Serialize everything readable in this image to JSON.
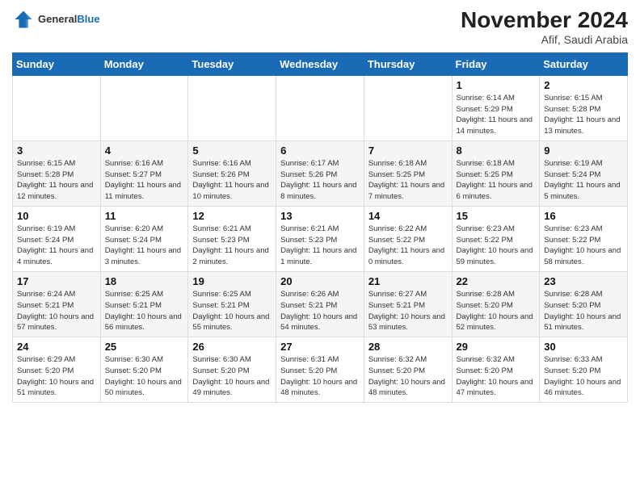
{
  "header": {
    "logo_general": "General",
    "logo_blue": "Blue",
    "month_title": "November 2024",
    "location": "Afif, Saudi Arabia"
  },
  "columns": [
    "Sunday",
    "Monday",
    "Tuesday",
    "Wednesday",
    "Thursday",
    "Friday",
    "Saturday"
  ],
  "weeks": [
    [
      {
        "day": "",
        "info": ""
      },
      {
        "day": "",
        "info": ""
      },
      {
        "day": "",
        "info": ""
      },
      {
        "day": "",
        "info": ""
      },
      {
        "day": "",
        "info": ""
      },
      {
        "day": "1",
        "info": "Sunrise: 6:14 AM\nSunset: 5:29 PM\nDaylight: 11 hours and 14 minutes."
      },
      {
        "day": "2",
        "info": "Sunrise: 6:15 AM\nSunset: 5:28 PM\nDaylight: 11 hours and 13 minutes."
      }
    ],
    [
      {
        "day": "3",
        "info": "Sunrise: 6:15 AM\nSunset: 5:28 PM\nDaylight: 11 hours and 12 minutes."
      },
      {
        "day": "4",
        "info": "Sunrise: 6:16 AM\nSunset: 5:27 PM\nDaylight: 11 hours and 11 minutes."
      },
      {
        "day": "5",
        "info": "Sunrise: 6:16 AM\nSunset: 5:26 PM\nDaylight: 11 hours and 10 minutes."
      },
      {
        "day": "6",
        "info": "Sunrise: 6:17 AM\nSunset: 5:26 PM\nDaylight: 11 hours and 8 minutes."
      },
      {
        "day": "7",
        "info": "Sunrise: 6:18 AM\nSunset: 5:25 PM\nDaylight: 11 hours and 7 minutes."
      },
      {
        "day": "8",
        "info": "Sunrise: 6:18 AM\nSunset: 5:25 PM\nDaylight: 11 hours and 6 minutes."
      },
      {
        "day": "9",
        "info": "Sunrise: 6:19 AM\nSunset: 5:24 PM\nDaylight: 11 hours and 5 minutes."
      }
    ],
    [
      {
        "day": "10",
        "info": "Sunrise: 6:19 AM\nSunset: 5:24 PM\nDaylight: 11 hours and 4 minutes."
      },
      {
        "day": "11",
        "info": "Sunrise: 6:20 AM\nSunset: 5:24 PM\nDaylight: 11 hours and 3 minutes."
      },
      {
        "day": "12",
        "info": "Sunrise: 6:21 AM\nSunset: 5:23 PM\nDaylight: 11 hours and 2 minutes."
      },
      {
        "day": "13",
        "info": "Sunrise: 6:21 AM\nSunset: 5:23 PM\nDaylight: 11 hours and 1 minute."
      },
      {
        "day": "14",
        "info": "Sunrise: 6:22 AM\nSunset: 5:22 PM\nDaylight: 11 hours and 0 minutes."
      },
      {
        "day": "15",
        "info": "Sunrise: 6:23 AM\nSunset: 5:22 PM\nDaylight: 10 hours and 59 minutes."
      },
      {
        "day": "16",
        "info": "Sunrise: 6:23 AM\nSunset: 5:22 PM\nDaylight: 10 hours and 58 minutes."
      }
    ],
    [
      {
        "day": "17",
        "info": "Sunrise: 6:24 AM\nSunset: 5:21 PM\nDaylight: 10 hours and 57 minutes."
      },
      {
        "day": "18",
        "info": "Sunrise: 6:25 AM\nSunset: 5:21 PM\nDaylight: 10 hours and 56 minutes."
      },
      {
        "day": "19",
        "info": "Sunrise: 6:25 AM\nSunset: 5:21 PM\nDaylight: 10 hours and 55 minutes."
      },
      {
        "day": "20",
        "info": "Sunrise: 6:26 AM\nSunset: 5:21 PM\nDaylight: 10 hours and 54 minutes."
      },
      {
        "day": "21",
        "info": "Sunrise: 6:27 AM\nSunset: 5:21 PM\nDaylight: 10 hours and 53 minutes."
      },
      {
        "day": "22",
        "info": "Sunrise: 6:28 AM\nSunset: 5:20 PM\nDaylight: 10 hours and 52 minutes."
      },
      {
        "day": "23",
        "info": "Sunrise: 6:28 AM\nSunset: 5:20 PM\nDaylight: 10 hours and 51 minutes."
      }
    ],
    [
      {
        "day": "24",
        "info": "Sunrise: 6:29 AM\nSunset: 5:20 PM\nDaylight: 10 hours and 51 minutes."
      },
      {
        "day": "25",
        "info": "Sunrise: 6:30 AM\nSunset: 5:20 PM\nDaylight: 10 hours and 50 minutes."
      },
      {
        "day": "26",
        "info": "Sunrise: 6:30 AM\nSunset: 5:20 PM\nDaylight: 10 hours and 49 minutes."
      },
      {
        "day": "27",
        "info": "Sunrise: 6:31 AM\nSunset: 5:20 PM\nDaylight: 10 hours and 48 minutes."
      },
      {
        "day": "28",
        "info": "Sunrise: 6:32 AM\nSunset: 5:20 PM\nDaylight: 10 hours and 48 minutes."
      },
      {
        "day": "29",
        "info": "Sunrise: 6:32 AM\nSunset: 5:20 PM\nDaylight: 10 hours and 47 minutes."
      },
      {
        "day": "30",
        "info": "Sunrise: 6:33 AM\nSunset: 5:20 PM\nDaylight: 10 hours and 46 minutes."
      }
    ]
  ]
}
